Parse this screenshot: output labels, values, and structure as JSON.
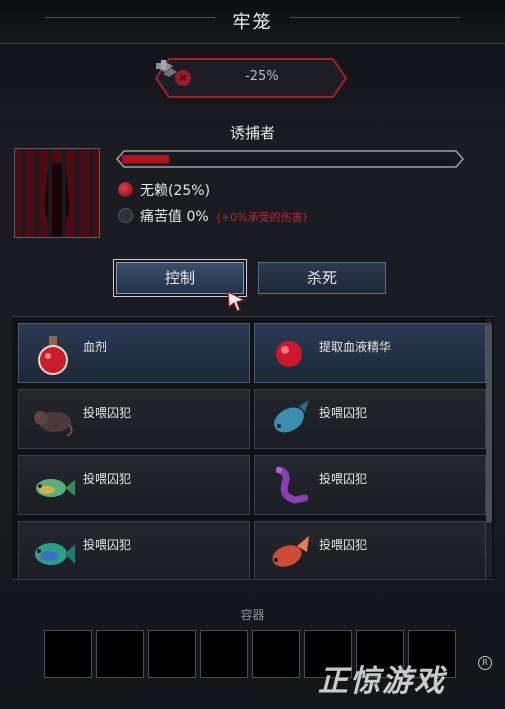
{
  "window": {
    "title": "牢笼"
  },
  "buff": {
    "value": "-25%"
  },
  "prisoner": {
    "name": "诱捕者",
    "health_fraction": 0.14,
    "trait": "无赖(25%)",
    "pain_label": "痛苦值 0%",
    "pain_note": "(+0%承受的伤害)"
  },
  "actions": {
    "control": "控制",
    "kill": "杀死"
  },
  "slots": [
    {
      "label": "血剂",
      "icon": "blood-potion-icon"
    },
    {
      "label": "提取血液精华",
      "icon": "blood-essence-icon"
    },
    {
      "label": "投喂囚犯",
      "icon": "rat-icon"
    },
    {
      "label": "投喂囚犯",
      "icon": "blue-fish-icon"
    },
    {
      "label": "投喂囚犯",
      "icon": "rainbow-fish-icon"
    },
    {
      "label": "投喂囚犯",
      "icon": "purple-eel-icon"
    },
    {
      "label": "投喂囚犯",
      "icon": "green-fish-icon"
    },
    {
      "label": "投喂囚犯",
      "icon": "red-fish-icon"
    }
  ],
  "container": {
    "label": "容器",
    "slot_count": 8
  },
  "watermark": {
    "text": "正惊游戏"
  },
  "colors": {
    "accent_red": "#c7202c",
    "button_blue": "#3a4f6b"
  }
}
